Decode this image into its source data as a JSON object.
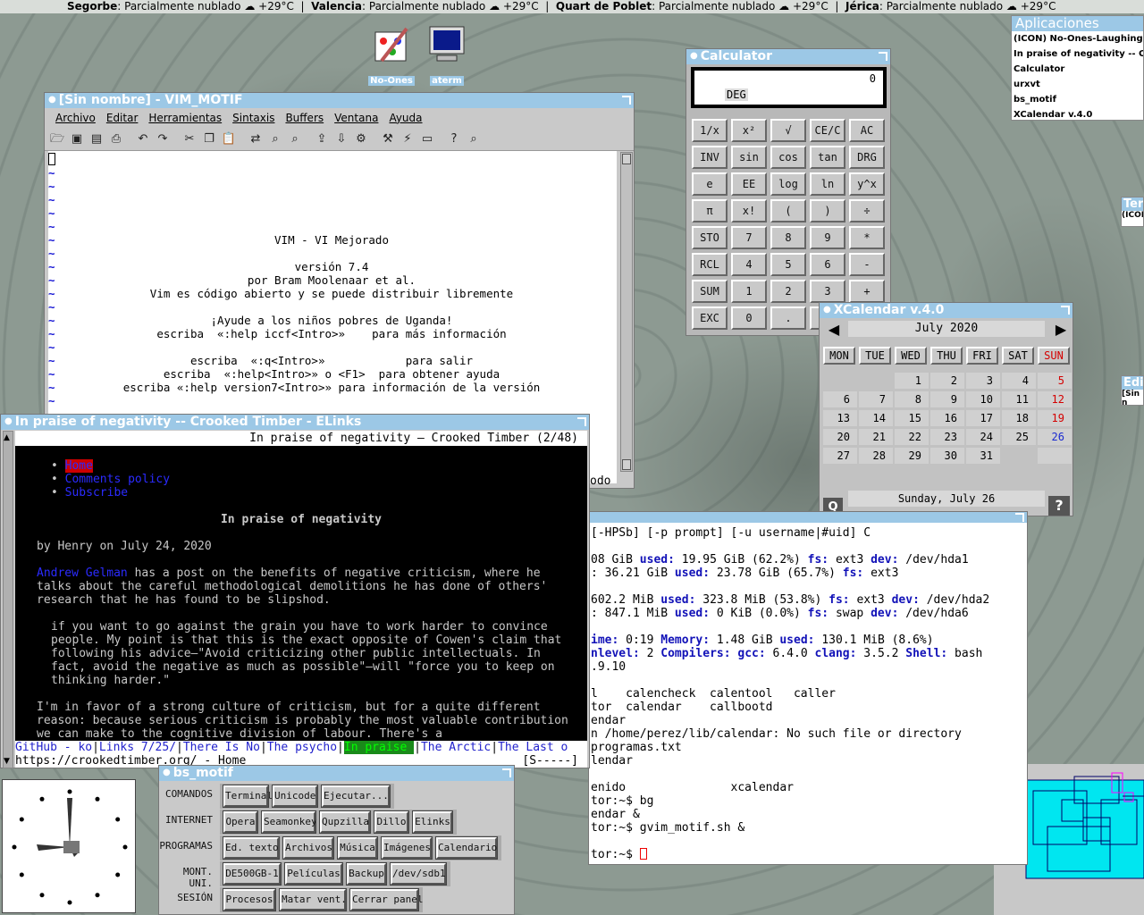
{
  "weather": [
    {
      "city": "Segorbe",
      "cond": ": Parcialmente nublado ☁ +29°C  |  "
    },
    {
      "city": "Valencia",
      "cond": ": Parcialmente nublado ☁ +29°C  |  "
    },
    {
      "city": "Quart de Poblet",
      "cond": ": Parcialmente nublado ☁ +29°C  |  "
    },
    {
      "city": "Jérica",
      "cond": ": Parcialmente nublado ☁ +29°C"
    }
  ],
  "desktop_icons": {
    "noones": "No-Ones",
    "aterm": "aterm"
  },
  "apps_panel": {
    "title": "Aplicaciones",
    "items": [
      "(ICON) No-Ones-Laughing-1.",
      "In praise of negativity -- Croo",
      "Calculator",
      "urxvt",
      "bs_motif",
      "XCalendar v.4.0"
    ]
  },
  "vim": {
    "title": "[Sin nombre] - VIM_MOTIF",
    "menu": [
      "Archivo",
      "Editar",
      "Herramientas",
      "Sintaxis",
      "Buffers",
      "Ventana",
      "Ayuda"
    ],
    "lines": [
      "",
      "",
      "",
      "",
      "",
      "VIM - VI Mejorado",
      "",
      "versión 7.4",
      "por Bram Moolenaar et al.",
      "Vim es código abierto y se puede distribuir libremente",
      "",
      "¡Ayude a los niños pobres de Uganda!",
      "escriba  «:help iccf<Intro>»    para más información",
      "",
      "escriba  «:q<Intro>»            para salir",
      "escriba  «:help<Intro>» o <F1>  para obtener ayuda",
      "escriba «:help version7<Intro>» para información de la versión"
    ],
    "status_tail": "odo"
  },
  "elinks": {
    "title": "In praise of negativity -- Crooked Timber - ELinks",
    "header": "In praise of negativity — Crooked Timber (2/48)",
    "links": [
      "Home",
      "Comments policy",
      "Subscribe"
    ],
    "heading": "In praise of negativity",
    "byline": "by Henry on July 24, 2020",
    "p1_link": "Andrew Gelman",
    "p1": " has a post on the benefits of negative criticism, where he talks about the careful methodological demolitions he has done of others' research that he has found to be slipshod.",
    "quote": "if you want to go against the grain you have to work harder to convince people. My point is that this is the exact opposite of Cowen's claim that following his advice—\"Avoid criticizing other public intellectuals. In fact, avoid the negative as much as possible\"—will \"force you to keep on thinking harder.\"",
    "p2": "I'm in favor of a strong culture of criticism, but for a quite different reason: because serious criticism is probably the most valuable contribution we can make to the cognitive division of labour. There's a",
    "tabs": [
      "GitHub - ko",
      "Links 7/25/",
      "There Is No",
      "The psycho",
      "In praise ",
      "The Arctic",
      "The Last o"
    ],
    "url": "https://crookedtimber.org/ - Home",
    "mode": "[S-----]"
  },
  "calculator": {
    "title": "Calculator",
    "display": "0",
    "mode": "DEG",
    "buttons": [
      [
        "1/x",
        "x²",
        "√",
        "CE/C",
        "AC"
      ],
      [
        "INV",
        "sin",
        "cos",
        "tan",
        "DRG"
      ],
      [
        "e",
        "EE",
        "log",
        "ln",
        "y^x"
      ],
      [
        "π",
        "x!",
        "(",
        ")",
        "÷"
      ],
      [
        "STO",
        "7",
        "8",
        "9",
        "*"
      ],
      [
        "RCL",
        "4",
        "5",
        "6",
        "-"
      ],
      [
        "SUM",
        "1",
        "2",
        "3",
        "+"
      ],
      [
        "EXC",
        "0",
        ".",
        "=",
        ""
      ]
    ]
  },
  "xcalendar": {
    "title": "XCalendar v.4.0",
    "month": "July 2020",
    "days": [
      "MON",
      "TUE",
      "WED",
      "THU",
      "FRI",
      "SAT",
      "SUN"
    ],
    "weeks": [
      [
        "",
        "",
        "1",
        "2",
        "3",
        "4",
        "5"
      ],
      [
        "6",
        "7",
        "8",
        "9",
        "10",
        "11",
        "12"
      ],
      [
        "13",
        "14",
        "15",
        "16",
        "17",
        "18",
        "19"
      ],
      [
        "20",
        "21",
        "22",
        "23",
        "24",
        "25",
        "26"
      ],
      [
        "27",
        "28",
        "29",
        "30",
        "31",
        "",
        ""
      ]
    ],
    "today": "Sunday, July 26",
    "help": "?",
    "quit": "Q"
  },
  "terminal": {
    "lines": [
      [
        [
          "",
          "[-HPSb] [-p prompt] [-u username|#uid] C"
        ]
      ],
      [
        [
          "",
          ""
        ]
      ],
      [
        [
          "",
          "08 GiB "
        ],
        [
          "b",
          "used:"
        ],
        [
          "",
          " 19.95 GiB (62.2%) "
        ],
        [
          "b",
          "fs:"
        ],
        [
          "",
          " ext3 "
        ],
        [
          "b",
          "dev:"
        ],
        [
          "",
          " /dev/hda1"
        ]
      ],
      [
        [
          "",
          ": 36.21 GiB "
        ],
        [
          "b",
          "used:"
        ],
        [
          "",
          " 23.78 GiB (65.7%) "
        ],
        [
          "b",
          "fs:"
        ],
        [
          "",
          " ext3"
        ]
      ],
      [
        [
          "",
          ""
        ]
      ],
      [
        [
          "",
          "602.2 MiB "
        ],
        [
          "b",
          "used:"
        ],
        [
          "",
          " 323.8 MiB (53.8%) "
        ],
        [
          "b",
          "fs:"
        ],
        [
          "",
          " ext3 "
        ],
        [
          "b",
          "dev:"
        ],
        [
          "",
          " /dev/hda2"
        ]
      ],
      [
        [
          "",
          ": 847.1 MiB "
        ],
        [
          "b",
          "used:"
        ],
        [
          "",
          " 0 KiB (0.0%) "
        ],
        [
          "b",
          "fs:"
        ],
        [
          "",
          " swap "
        ],
        [
          "b",
          "dev:"
        ],
        [
          "",
          " /dev/hda6"
        ]
      ],
      [
        [
          "",
          ""
        ]
      ],
      [
        [
          "b",
          "ime:"
        ],
        [
          "",
          " 0:19 "
        ],
        [
          "b",
          "Memory:"
        ],
        [
          "",
          " 1.48 GiB "
        ],
        [
          "b",
          "used:"
        ],
        [
          "",
          " 130.1 MiB (8.6%)"
        ]
      ],
      [
        [
          "b",
          "nlevel:"
        ],
        [
          "",
          " 2 "
        ],
        [
          "b",
          "Compilers:"
        ],
        [
          "",
          " "
        ],
        [
          "b",
          "gcc:"
        ],
        [
          "",
          " 6.4.0 "
        ],
        [
          "b",
          "clang:"
        ],
        [
          "",
          " 3.5.2 "
        ],
        [
          "b",
          "Shell:"
        ],
        [
          "",
          " bash"
        ]
      ],
      [
        [
          "",
          ".9.10"
        ]
      ],
      [
        [
          "",
          ""
        ]
      ],
      [
        [
          "",
          "l    calencheck  calentool   caller"
        ]
      ],
      [
        [
          "",
          "tor  calendar    callbootd"
        ]
      ],
      [
        [
          "",
          "endar"
        ]
      ],
      [
        [
          "",
          "n /home/perez/lib/calendar: No such file or directory"
        ]
      ],
      [
        [
          "",
          "programas.txt"
        ]
      ],
      [
        [
          "",
          "lendar"
        ]
      ],
      [
        [
          "",
          ""
        ]
      ],
      [
        [
          "",
          "enido               xcalendar"
        ]
      ],
      [
        [
          "",
          "tor:~$ bg"
        ]
      ],
      [
        [
          "",
          "endar &"
        ]
      ],
      [
        [
          "",
          "tor:~$ gvim_motif.sh &"
        ]
      ],
      [
        [
          "",
          ""
        ]
      ],
      [
        [
          "",
          "tor:~$ "
        ]
      ]
    ]
  },
  "bs_motif": {
    "title": "bs_motif",
    "rows": [
      {
        "label": "COMANDOS",
        "buttons": [
          "Terminal",
          "Unicode",
          "Ejecutar..."
        ]
      },
      {
        "label": "INTERNET",
        "buttons": [
          "Opera",
          "Seamonkey",
          "Qupzilla",
          "Dillo",
          "Elinks"
        ]
      },
      {
        "label": "PROGRAMAS",
        "buttons": [
          "Ed. texto",
          "Archivos",
          "Música",
          "Imágenes",
          "Calendario"
        ]
      },
      {
        "label": "MONT. UNI.",
        "buttons": [
          "DE500GB-1",
          "Películas",
          "Backup",
          "/dev/sdb1"
        ]
      },
      {
        "label": "SESIÓN",
        "buttons": [
          "Procesos",
          "Matar vent.",
          "Cerrar panel"
        ]
      }
    ]
  },
  "side_windows": {
    "ter": "Ter",
    "icon_frag": "(ICON",
    "edi": "Edi",
    "sin_frag": "[Sin n"
  },
  "colors": {
    "title_bar": "#9cc8e6",
    "link": "#2b2bff",
    "elinks_bg": "#000000",
    "sunday": "#d40000",
    "cyan_block": "#00e6f0"
  }
}
